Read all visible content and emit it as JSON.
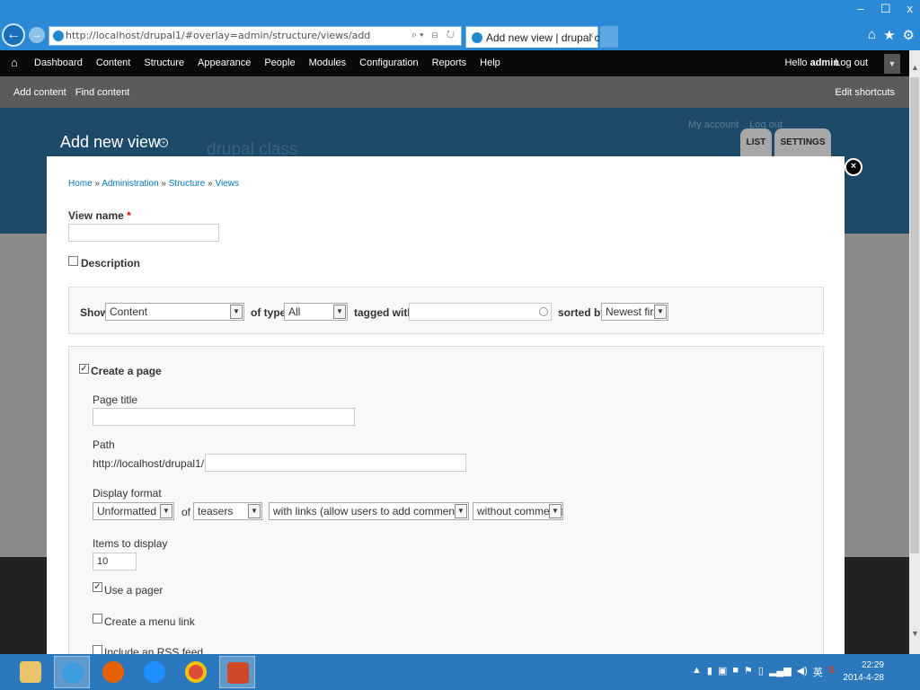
{
  "browser": {
    "url": "http://localhost/drupal1/#overlay=admin/structure/views/add",
    "tab_title": "Add new view | drupal cl...",
    "tab_close": "×",
    "window_controls": [
      "–",
      "☐",
      "x"
    ]
  },
  "toolbar": {
    "menu": [
      "Dashboard",
      "Content",
      "Structure",
      "Appearance",
      "People",
      "Modules",
      "Configuration",
      "Reports",
      "Help"
    ],
    "hello": "Hello",
    "username": "admin",
    "logout": "Log out"
  },
  "shortcuts": {
    "links": [
      "Add content",
      "Find content"
    ],
    "edit": "Edit shortcuts"
  },
  "site": {
    "name": "drupal class",
    "account_links": [
      "My account",
      "Log out"
    ]
  },
  "overlay": {
    "title": "Add new view",
    "tabs": [
      "LIST",
      "SETTINGS"
    ],
    "close": "×"
  },
  "breadcrumb": [
    "Home",
    "Administration",
    "Structure",
    "Views"
  ],
  "form": {
    "view_name_label": "View name",
    "required_mark": "*",
    "view_name_value": "",
    "description_label": "Description",
    "description_checked": false,
    "show_label": "Show",
    "show_value": "Content",
    "of_type_label": "of type",
    "of_type_value": "All",
    "tagged_with_label": "tagged with",
    "tagged_with_value": "",
    "sorted_by_label": "sorted by",
    "sorted_by_value": "Newest first",
    "create_page_label": "Create a page",
    "create_page_checked": true,
    "page_title_label": "Page title",
    "page_title_value": "",
    "path_label": "Path",
    "path_prefix": "http://localhost/drupal1/",
    "path_value": "",
    "display_format_label": "Display format",
    "display_format_style": "Unformatted list",
    "of_word": "of",
    "display_format_row": "teasers",
    "display_format_links": "with links (allow users to add comments, etc.)",
    "display_format_comments": "without comments",
    "items_label": "Items to display",
    "items_value": "10",
    "use_pager_label": "Use a pager",
    "use_pager_checked": true,
    "menu_link_label": "Create a menu link",
    "menu_link_checked": false,
    "rss_label": "Include an RSS feed",
    "rss_checked": false
  },
  "taskbar": {
    "time": "22:29",
    "date": "2014-4-28",
    "tray_text": "英"
  },
  "colors": {
    "ie_blue": "#2a8ad6",
    "toolbar_black": "#0a0a0a",
    "shortcut_gray": "#5b5b5b",
    "link_blue": "#0074bd",
    "taskbar_blue": "#2b78bd"
  }
}
